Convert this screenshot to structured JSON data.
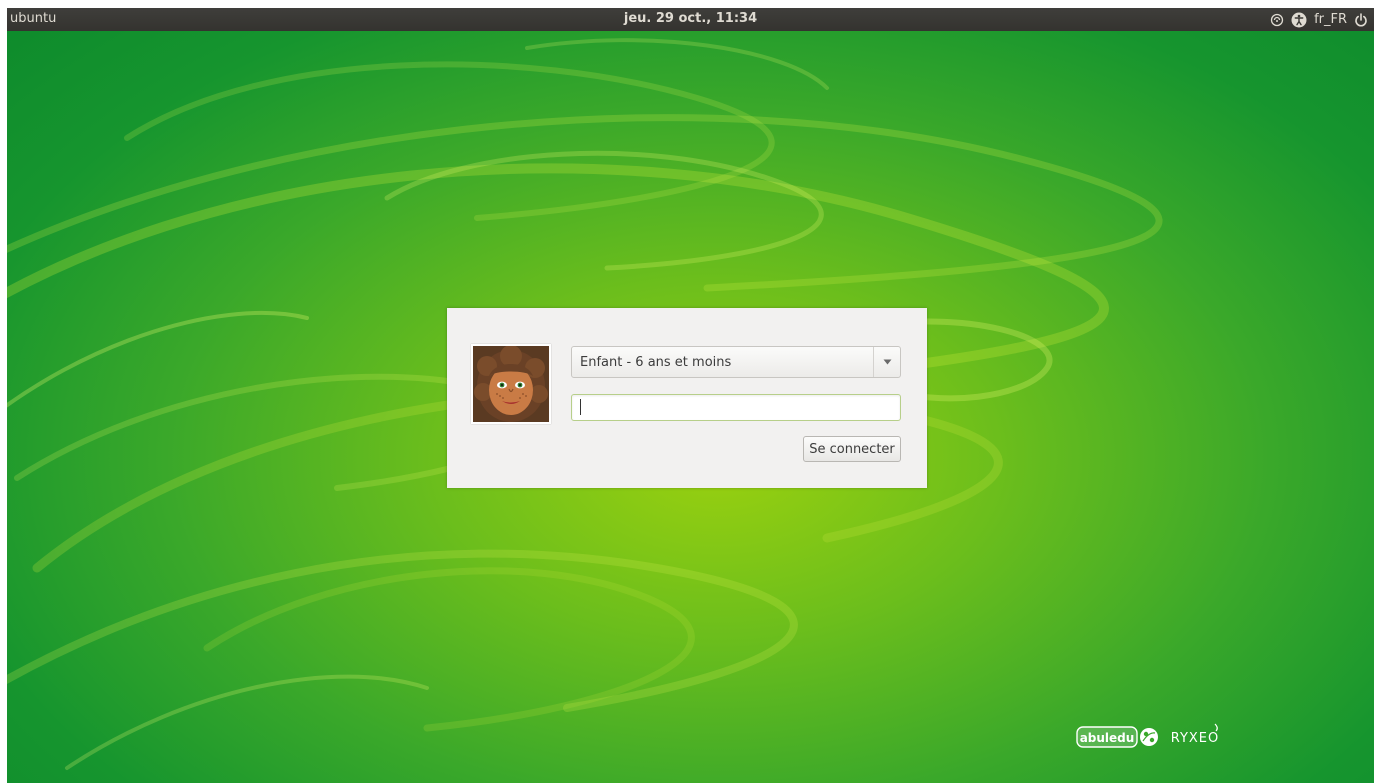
{
  "topbar": {
    "hostname": "ubuntu",
    "clock": "jeu. 29 oct., 11:34",
    "keyboard_layout": "fr_FR",
    "icons": [
      "network-icon",
      "accessibility-icon",
      "power-icon"
    ]
  },
  "login": {
    "selected_user": "Enfant - 6 ans et moins",
    "password_value": "",
    "password_placeholder": "",
    "connect_label": "Se connecter",
    "avatar": "child-girl-avatar"
  },
  "branding": {
    "logo": "abuledu-ryxeo-logo"
  },
  "colors": {
    "topbar": "#3c3b37",
    "dialog": "#f2f1f0",
    "wallpaper_light": "#9bd10f",
    "wallpaper_dark": "#0d8a2c",
    "focus_border": "#b7cf8a"
  }
}
